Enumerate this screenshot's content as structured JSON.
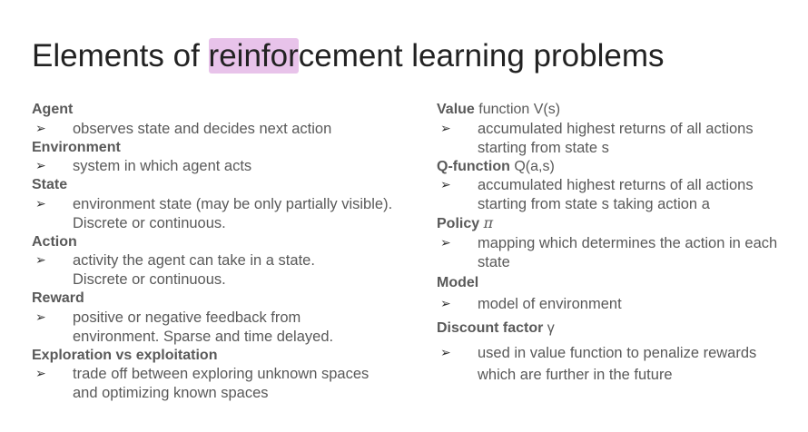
{
  "title": {
    "before": "Elements of ",
    "highlight": "reinfor",
    "after": "cement learning problems"
  },
  "bullet_glyph": "➢",
  "left_column": {
    "agent": {
      "term": "Agent",
      "desc": [
        "observes state and decides next action"
      ]
    },
    "environment": {
      "term": "Environment",
      "desc": [
        "system in which agent acts"
      ]
    },
    "state": {
      "term": "State",
      "desc": [
        "environment state (may be only partially visible). Discrete or continuous."
      ]
    },
    "action": {
      "term": "Action",
      "desc": [
        "activity the agent can take in a state. Discrete or continuous."
      ]
    },
    "reward": {
      "term": "Reward",
      "desc": [
        "positive or negative feedback from environment. Sparse and time delayed."
      ]
    },
    "exploration": {
      "term": "Exploration vs exploitation",
      "desc": [
        "trade off between exploring unknown spaces and optimizing known spaces"
      ]
    }
  },
  "right_column": {
    "value": {
      "term": "Value",
      "suffix": " function V(s)",
      "desc": "accumulated highest returns of all actions starting from state s"
    },
    "qfunction": {
      "term": "Q-function",
      "suffix": " Q(a,s)",
      "desc": "accumulated highest returns of all actions starting from state s taking action a"
    },
    "policy": {
      "term": "Policy",
      "symbol": "π",
      "desc": "mapping which determines the action in each state"
    },
    "model": {
      "term": "Model",
      "desc": "model of environment"
    },
    "discount": {
      "term": "Discount factor",
      "suffix": " γ",
      "desc": "used in value function to penalize rewards which are further in the future"
    }
  }
}
